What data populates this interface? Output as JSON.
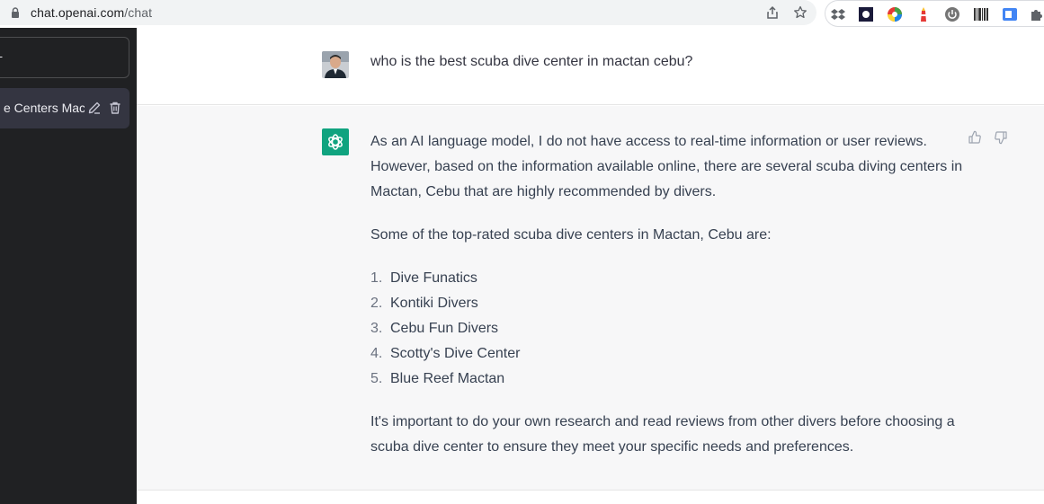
{
  "browser": {
    "url_host": "chat.openai.com",
    "url_path": "/chat"
  },
  "sidebar": {
    "new_chat_glyph": "+",
    "conversation_label": "e Centers Mac"
  },
  "chat": {
    "user_message": "who is the best scuba dive center in mactan cebu?",
    "assistant_intro": "As an AI language model, I do not have access to real-time information or user reviews. However, based on the information available online, there are several scuba diving centers in Mactan, Cebu that are highly recommended by divers.",
    "assistant_list_intro": "Some of the top-rated scuba dive centers in Mactan, Cebu are:",
    "list": [
      {
        "num": "1.",
        "text": "Dive Funatics"
      },
      {
        "num": "2.",
        "text": "Kontiki Divers"
      },
      {
        "num": "3.",
        "text": "Cebu Fun Divers"
      },
      {
        "num": "4.",
        "text": "Scotty's Dive Center"
      },
      {
        "num": "5.",
        "text": "Blue Reef Mactan"
      }
    ],
    "assistant_outro": "It's important to do your own research and read reviews from other divers before choosing a scuba dive center to ensure they meet your specific needs and preferences."
  },
  "colors": {
    "sidebar_bg": "#202123",
    "gpt_green": "#10a37f",
    "assistant_bg": "#f7f7f8"
  }
}
